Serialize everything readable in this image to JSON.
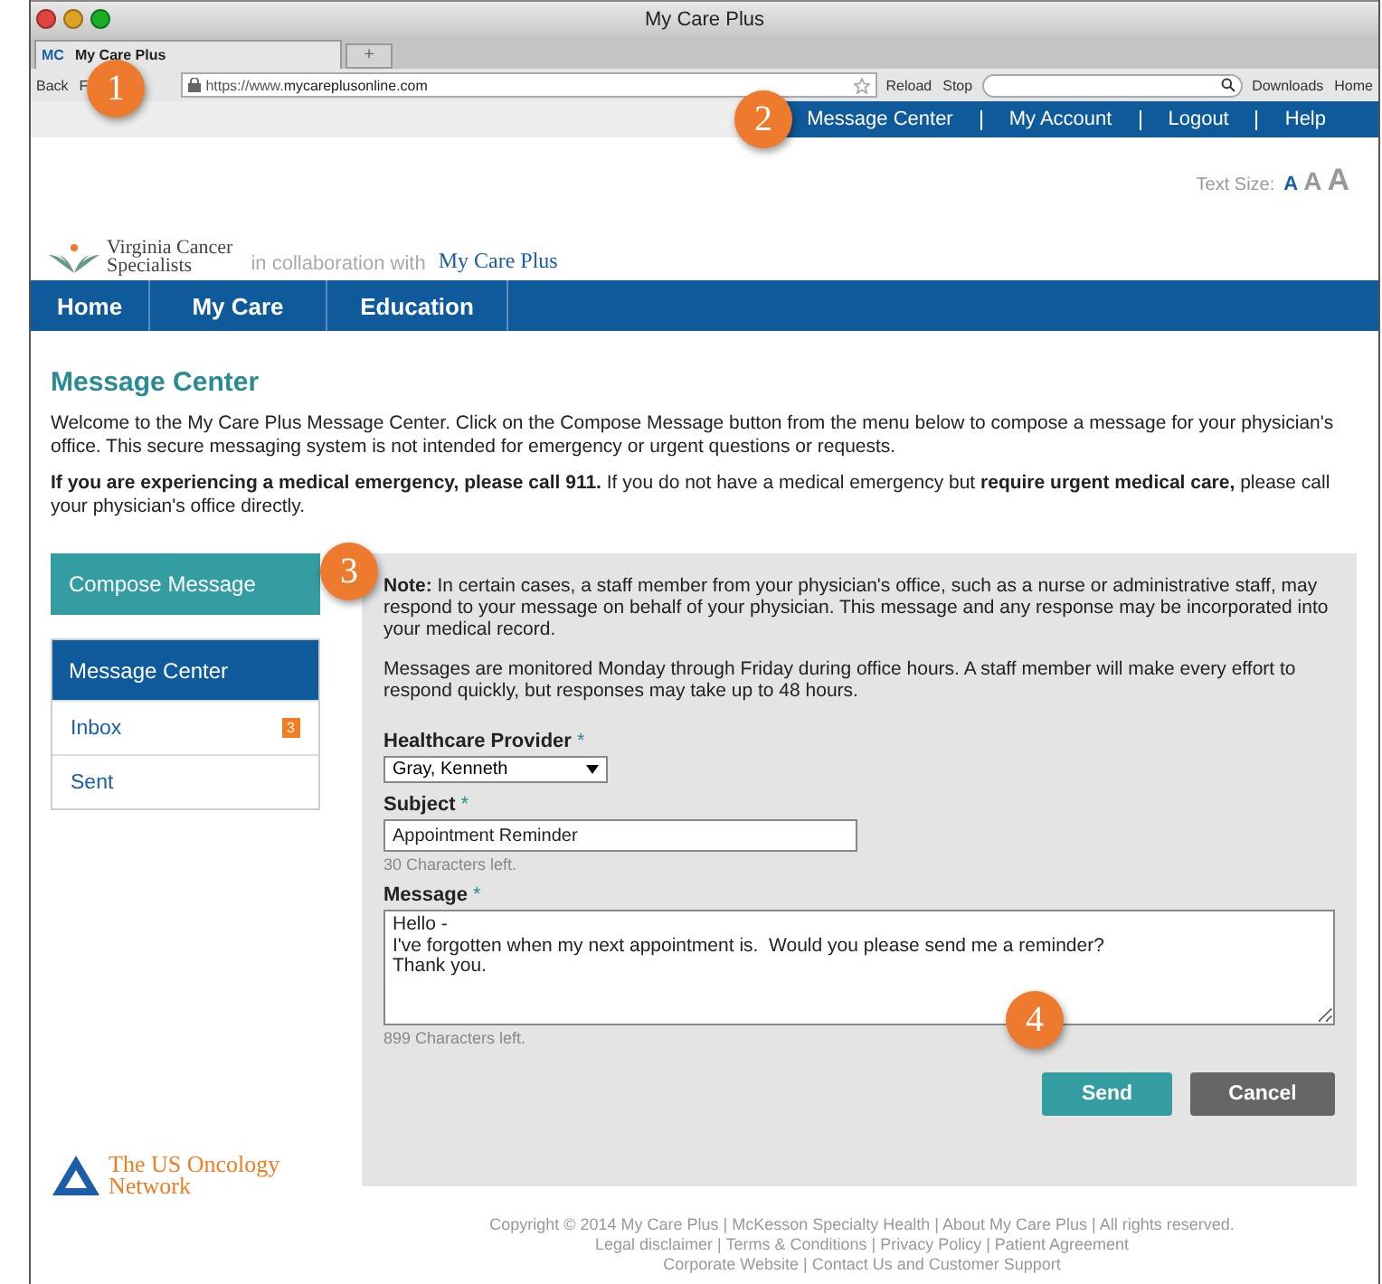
{
  "window": {
    "title": "My Care Plus"
  },
  "browser": {
    "tab": {
      "icon_text": "MC",
      "label": "My Care Plus"
    },
    "new_tab": "+",
    "nav": [
      "Back",
      "F"
    ],
    "url_prefix": "https://www.",
    "url_domain": "mycareplusonline.com",
    "actions": [
      "Reload",
      "Stop"
    ],
    "bookmarks": [
      "Downloads",
      "Home"
    ]
  },
  "top_nav": [
    "Message Center",
    "My Account",
    "Logout",
    "Help"
  ],
  "text_size": {
    "label": "Text Size:",
    "options": [
      "A",
      "A",
      "A"
    ]
  },
  "logo": {
    "name_line1": "Virginia Cancer",
    "name_line2": "Specialists",
    "collab": "in collaboration with",
    "brand": "My Care Plus"
  },
  "main_nav": [
    "Home",
    "My Care",
    "Education"
  ],
  "heading": "Message Center",
  "intro": "Welcome to the My Care Plus Message Center. Click on the Compose Message button from the menu below to compose a message for your physician's office. This secure messaging system is not intended for emergency or urgent questions or requests.",
  "emergency": "**If you are experiencing a medical emergency, please call 911.** If you do not have a medical emergency but **require urgent medical care,** please call your physician's office directly.",
  "compose_button": "Compose Message",
  "sidebar": {
    "title": "Message Center",
    "items": [
      {
        "label": "Inbox",
        "badge": "3"
      },
      {
        "label": "Sent"
      }
    ]
  },
  "panel": {
    "note": "**Note:** In certain cases, a staff member from your physician's office, such as a nurse or administrative staff, may respond to your message on behalf of your physician. This message and any response may be incorporated into your medical record.",
    "hours": "Messages are monitored Monday through Friday during office hours. A staff member will make every effort to respond quickly, but responses may take up to 48 hours.",
    "provider": {
      "label": "Healthcare Provider",
      "required": "*",
      "value": "Gray, Kenneth"
    },
    "subject": {
      "label": "Subject",
      "required": "*",
      "value": "Appointment Reminder",
      "hint": "30 Characters left."
    },
    "message": {
      "label": "Message",
      "required": "*",
      "value": "Hello -\nI've forgotten when my next appointment is.  Would you please send me a reminder?\nThank you.",
      "hint": "899 Characters left."
    },
    "buttons": [
      {
        "label": "Send",
        "kind": "primary"
      },
      {
        "label": "Cancel",
        "kind": "secondary"
      }
    ]
  },
  "partner_logo": {
    "line1": "The US Oncology",
    "line2": "Network"
  },
  "footer": [
    "Copyright © 2014 My Care Plus | McKesson Specialty Health | About My Care Plus | All rights reserved.",
    "Legal disclaimer | Terms & Conditions | Privacy Policy | Patient Agreement",
    "Corporate Website | Contact Us and Customer Support"
  ],
  "callouts": [
    "1",
    "2",
    "3",
    "4"
  ]
}
